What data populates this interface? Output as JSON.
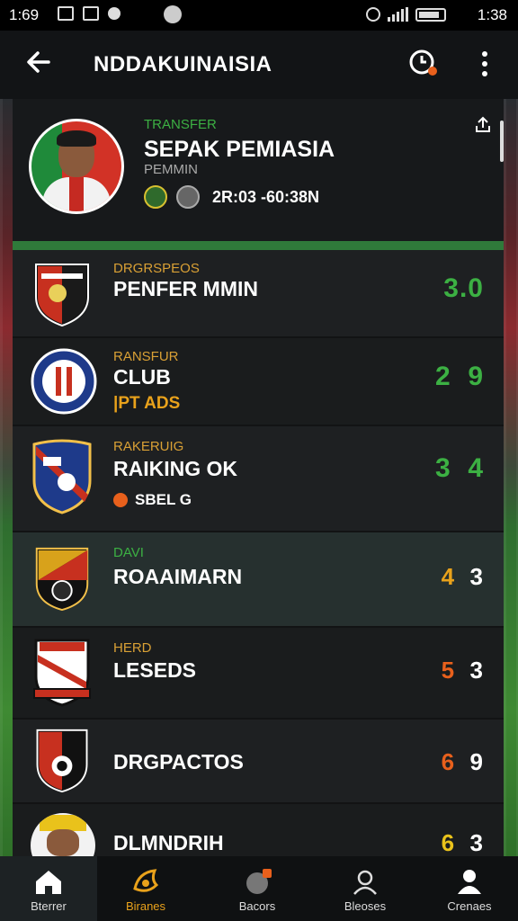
{
  "status": {
    "time_left": "1:69",
    "time_right": "1:38"
  },
  "appbar": {
    "title": "NDDAKUINAISIA",
    "back_icon": "arrow-left-icon",
    "alarm_icon": "alarm-clock-icon",
    "menu_icon": "more-vertical-icon"
  },
  "header_card": {
    "kicker": "TRANSFER",
    "title": "SEPAK PEMIASIA",
    "subtitle": "PEMMIN",
    "time_range": "2R:03 -60:38N",
    "share_icon": "share-icon"
  },
  "rows": [
    {
      "label": "DRGRSPEOS",
      "name": "PENFER MMIN",
      "extra": "",
      "score_a": "3.0",
      "score_b": "",
      "label_color": "#d9a035",
      "score_color": "#3cb043"
    },
    {
      "label": "RANSFUR",
      "name": "CLUB",
      "extra": "|PT ADS",
      "score_a": "2",
      "score_b": "9",
      "label_color": "#d9a035",
      "score_color": "#3cb043",
      "b_color": "#3cb043"
    },
    {
      "label": "RAKERUIG",
      "name": "RAIKING OK",
      "extra": "SBEL G",
      "score_a": "3",
      "score_b": "4",
      "label_color": "#d9a035",
      "score_color": "#3cb043",
      "b_color": "#3cb043"
    },
    {
      "label": "DAVI",
      "name": "ROAAIMARN",
      "extra": "",
      "score_a": "4",
      "score_b": "3",
      "label_color": "#3cb043",
      "score_color": "#e9a21b",
      "b_color": "#ffffff"
    },
    {
      "label": "HERD",
      "name": "LESEDS",
      "extra": "",
      "score_a": "5",
      "score_b": "3",
      "label_color": "#d9a035",
      "score_color": "#e8601c",
      "b_color": "#ffffff"
    },
    {
      "label": "",
      "name": "DRGPACTOS",
      "extra": "",
      "score_a": "6",
      "score_b": "9",
      "label_color": "#d9a035",
      "score_color": "#e8601c",
      "b_color": "#ffffff"
    },
    {
      "label": "",
      "name": "DLMNDRIH",
      "extra": "",
      "score_a": "6",
      "score_b": "3",
      "label_color": "#d9a035",
      "score_color": "#e9c21b",
      "b_color": "#ffffff"
    }
  ],
  "nav": [
    {
      "label": "Bterrer",
      "icon": "home-icon"
    },
    {
      "label": "Biranes",
      "icon": "trophy-icon"
    },
    {
      "label": "Bacors",
      "icon": "chat-icon"
    },
    {
      "label": "Bleoses",
      "icon": "user-search-icon"
    },
    {
      "label": "Crenaes",
      "icon": "person-icon"
    }
  ],
  "colors": {
    "accent_green": "#3cb043",
    "accent_gold": "#e9a21b"
  }
}
